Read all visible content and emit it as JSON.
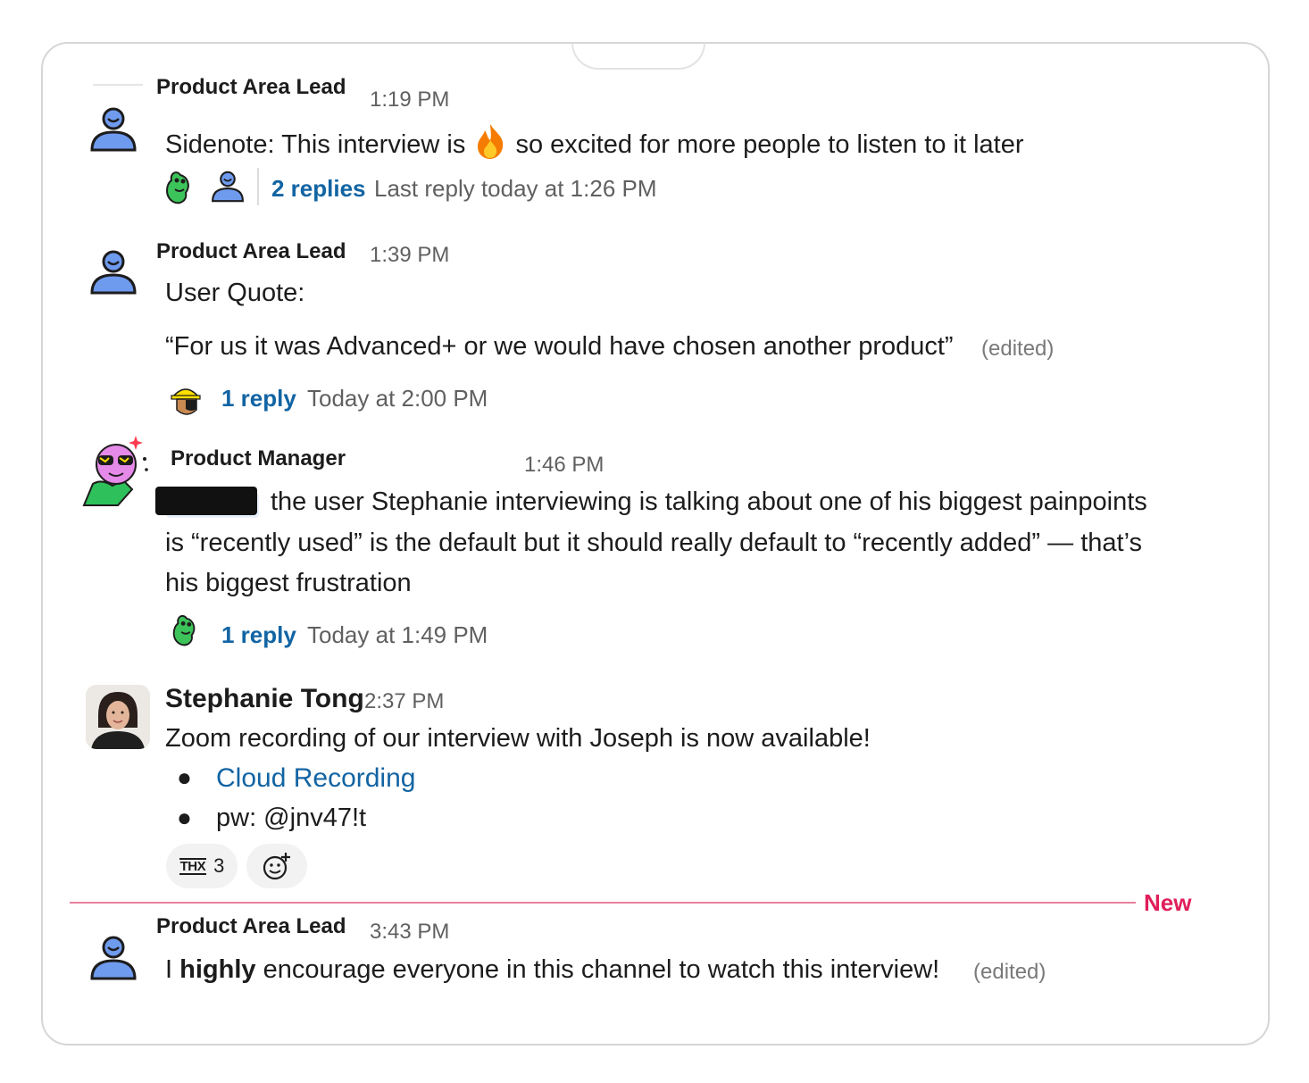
{
  "messages": [
    {
      "author": "Product Area Lead",
      "time": "1:19 PM",
      "text_before": "Sidenote: This interview is ",
      "emoji": "fire-icon",
      "text_after": " so excited for more people to listen to it later",
      "thread": {
        "replies": "2 replies",
        "meta": "Last reply today at 1:26 PM"
      }
    },
    {
      "author": "Product Area Lead",
      "time": "1:39 PM",
      "line1": "User Quote:",
      "line2": "“For us it was Advanced+ or we would have chosen another product”",
      "edited": "(edited)",
      "thread": {
        "replies": "1 reply",
        "meta": "Today at 2:00 PM"
      }
    },
    {
      "author": "Product Manager",
      "time": "1:46 PM",
      "line1": "the user Stephanie interviewing is talking about one of his biggest painpoints",
      "line2": "is “recently used” is the default but it should really default to “recently added” — that’s",
      "line3": "his biggest frustration",
      "thread": {
        "replies": "1 reply",
        "meta": "Today at 1:49 PM"
      }
    },
    {
      "author": "Stephanie Tong",
      "time": "2:37 PM",
      "text": "Zoom recording of our interview with Joseph is now available!",
      "bullets": [
        {
          "text": "Cloud Recording",
          "is_link": true
        },
        {
          "text": "pw: @jnv47!t",
          "is_link": false
        }
      ],
      "reactions": [
        {
          "emoji": "thx-icon",
          "label": "THX",
          "count": "3"
        },
        {
          "emoji": "add-reaction-icon"
        }
      ]
    },
    {
      "author": "Product Area Lead",
      "time": "3:43 PM",
      "text_pre": "I ",
      "text_bold": "highly",
      "text_post": " encourage everyone in this channel to watch this interview!",
      "edited": "(edited)"
    }
  ],
  "new_divider": "New",
  "colors": {
    "link": "#1264a3",
    "new_marker": "#e01e5a",
    "avatar_blue": "#6f9bef"
  }
}
